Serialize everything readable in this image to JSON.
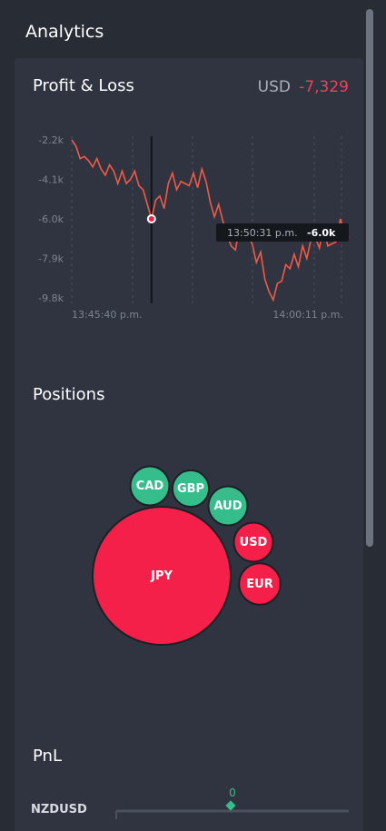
{
  "page": {
    "title": "Analytics"
  },
  "profit_loss": {
    "title": "Profit & Loss",
    "currency": "USD",
    "value": "-7,329",
    "tooltip_time": "13:50:31 p.m.",
    "tooltip_value": "-6.0k"
  },
  "positions": {
    "title": "Positions"
  },
  "pnl": {
    "title": "PnL",
    "rows": [
      {
        "label": "NZDUSD",
        "value": "0"
      }
    ]
  },
  "colors": {
    "line": "#f05a48",
    "positive": "#35bd8b",
    "negative": "#f5204a",
    "accent_red": "#f0405a"
  },
  "chart_data": [
    {
      "type": "line",
      "title": "Profit & Loss",
      "xlabel": "",
      "ylabel": "",
      "x_tick_labels": [
        "13:45:40 p.m.",
        "14:00:11 p.m."
      ],
      "y_tick_labels": [
        "-2.2k",
        "-4.1k",
        "-6.0k",
        "-7.9k",
        "-9.8k"
      ],
      "ylim": [
        -9800,
        -2200
      ],
      "grid": true,
      "series": [
        {
          "values": [
            -2200,
            -2500,
            -3100,
            -3000,
            -3200,
            -3500,
            -3100,
            -3600,
            -3900,
            -3400,
            -3700,
            -4300,
            -3700,
            -4300,
            -4100,
            -3700,
            -4400,
            -4600,
            -5300,
            -6000,
            -5100,
            -4900,
            -5500,
            -4300,
            -3800,
            -4600,
            -4200,
            -4300,
            -4400,
            -3800,
            -4500,
            -3600,
            -4200,
            -5200,
            -5900,
            -5300,
            -6100,
            -6800,
            -7300,
            -7500,
            -6400,
            -6300,
            -6800,
            -7200,
            -8100,
            -7600,
            -8900,
            -9500,
            -9900,
            -9100,
            -9000,
            -8200,
            -8400,
            -7700,
            -8300,
            -7300,
            -7900,
            -7000,
            -6900,
            -7400,
            -6400,
            -7300,
            -7200,
            -7100,
            -6000,
            -6700,
            -6900
          ],
          "highlight_point": {
            "x_index": 19,
            "y": -6000
          }
        }
      ]
    },
    {
      "type": "bubble",
      "title": "Positions",
      "series": [
        {
          "name": "JPY",
          "value": 100,
          "sign": "negative"
        },
        {
          "name": "CAD",
          "value": 8,
          "sign": "positive"
        },
        {
          "name": "GBP",
          "value": 7,
          "sign": "positive"
        },
        {
          "name": "AUD",
          "value": 8,
          "sign": "positive"
        },
        {
          "name": "USD",
          "value": 8,
          "sign": "negative"
        },
        {
          "name": "EUR",
          "value": 9,
          "sign": "negative"
        }
      ]
    }
  ]
}
